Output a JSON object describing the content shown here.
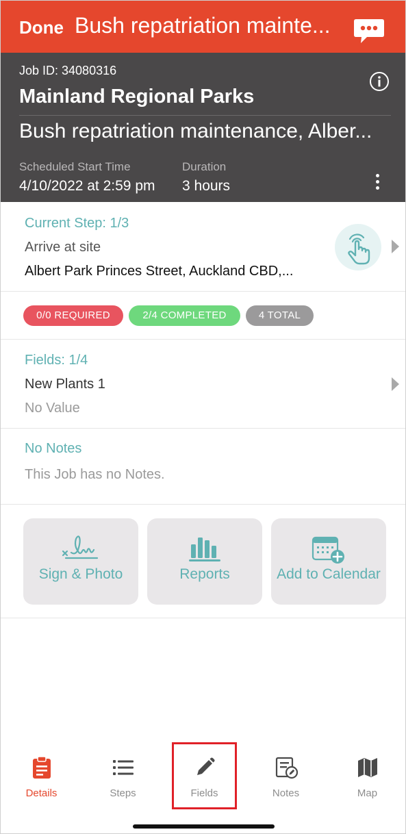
{
  "topbar": {
    "done_label": "Done",
    "title": "Bush repatriation mainte..."
  },
  "job": {
    "id_text": "Job ID: 34080316",
    "client": "Mainland Regional Parks",
    "title": "Bush repatriation maintenance, Alber...",
    "start_label": "Scheduled Start Time",
    "start_value": "4/10/2022 at 2:59 pm",
    "duration_label": "Duration",
    "duration_value": "3 hours"
  },
  "step": {
    "header": "Current Step: 1/3",
    "name": "Arrive at site",
    "address": "Albert Park Princes Street, Auckland CBD,..."
  },
  "pills": {
    "required": "0/0 REQUIRED",
    "completed": "2/4 COMPLETED",
    "total": "4 TOTAL"
  },
  "fields": {
    "header": "Fields: 1/4",
    "name": "New Plants 1",
    "value": "No Value"
  },
  "notes": {
    "header": "No Notes",
    "text": "This Job has no Notes."
  },
  "actions": {
    "sign_photo": "Sign & Photo",
    "reports": "Reports",
    "add_calendar": "Add to Calendar"
  },
  "tabs": {
    "details": "Details",
    "steps": "Steps",
    "fields": "Fields",
    "notes": "Notes",
    "map": "Map"
  },
  "colors": {
    "brand_red": "#e5472d",
    "header_dark": "#4a4849",
    "teal_accent": "#5fb1b2",
    "highlight_box": "#e02128"
  },
  "icons": {
    "chat": "chat-bubble-icon",
    "info": "info-icon",
    "more": "more-vertical-icon",
    "tap": "tap-hand-icon",
    "sign": "signature-icon",
    "reports": "bar-chart-icon",
    "calendar": "calendar-add-icon",
    "details": "clipboard-icon",
    "steps": "list-icon",
    "fields": "pencil-icon",
    "notes": "notes-icon",
    "map": "map-icon"
  }
}
